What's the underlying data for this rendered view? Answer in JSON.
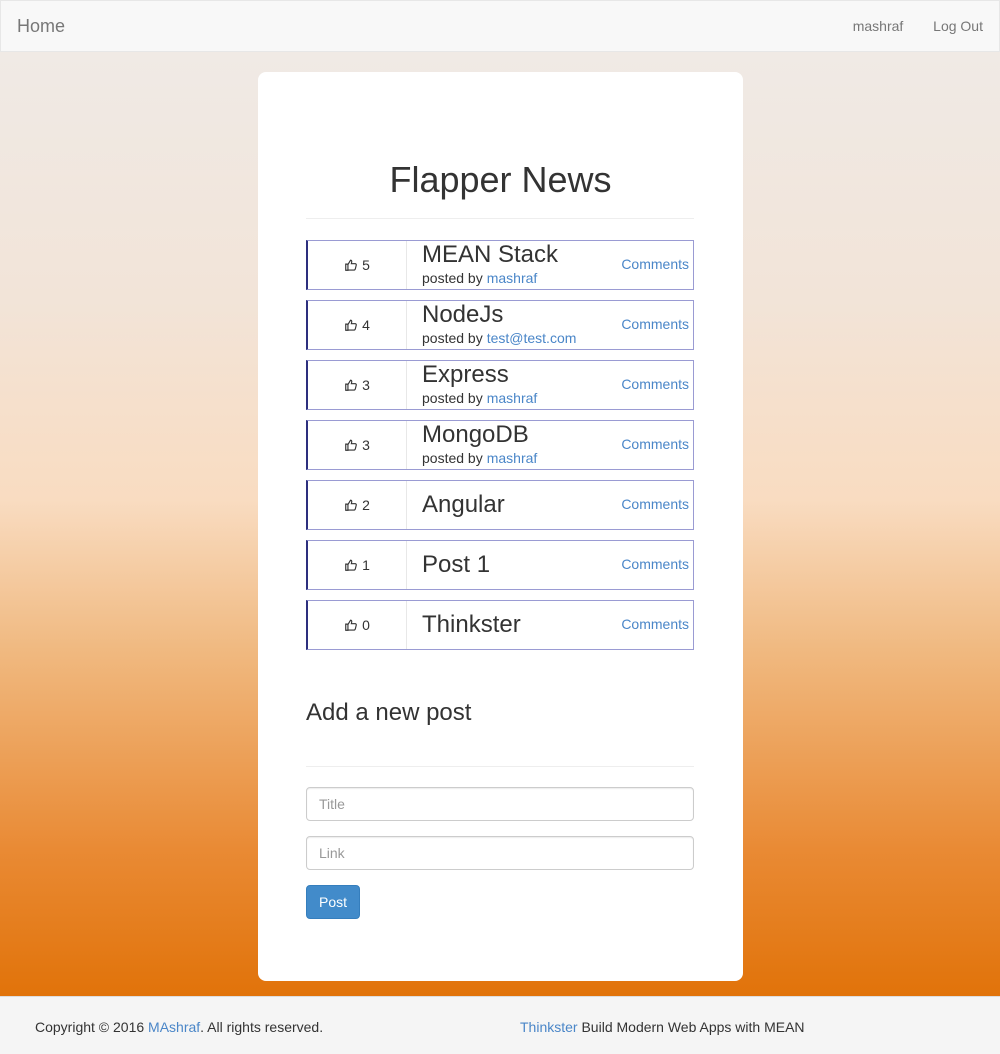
{
  "navbar": {
    "brand": "Home",
    "user": "mashraf",
    "logout": "Log Out"
  },
  "main": {
    "title": "Flapper News",
    "posted_by_label": "posted by",
    "comments_label": "Comments",
    "posts": [
      {
        "title": "MEAN Stack",
        "upvotes": "5",
        "author": "mashraf"
      },
      {
        "title": "NodeJs",
        "upvotes": "4",
        "author": "test@test.com"
      },
      {
        "title": "Express",
        "upvotes": "3",
        "author": "mashraf"
      },
      {
        "title": "MongoDB",
        "upvotes": "3",
        "author": "mashraf"
      },
      {
        "title": "Angular",
        "upvotes": "2",
        "author": ""
      },
      {
        "title": "Post 1",
        "upvotes": "1",
        "author": ""
      },
      {
        "title": "Thinkster",
        "upvotes": "0",
        "author": ""
      }
    ],
    "vote_icon": "thumbs-up-icon"
  },
  "form": {
    "heading": "Add a new post",
    "title_placeholder": "Title",
    "title_value": "",
    "link_placeholder": "Link",
    "link_value": "",
    "submit_label": "Post"
  },
  "footer": {
    "copyright_prefix": "Copyright © 2016",
    "copyright_link": "MAshraf",
    "copyright_suffix": ". All rights reserved.",
    "thinkster_link": "Thinkster",
    "tagline": "Build Modern Web Apps with MEAN"
  },
  "colors": {
    "link": "#4a86c8",
    "post_border": "#9a9bd3",
    "post_accent": "#2d2f7e",
    "button": "#428bca"
  }
}
